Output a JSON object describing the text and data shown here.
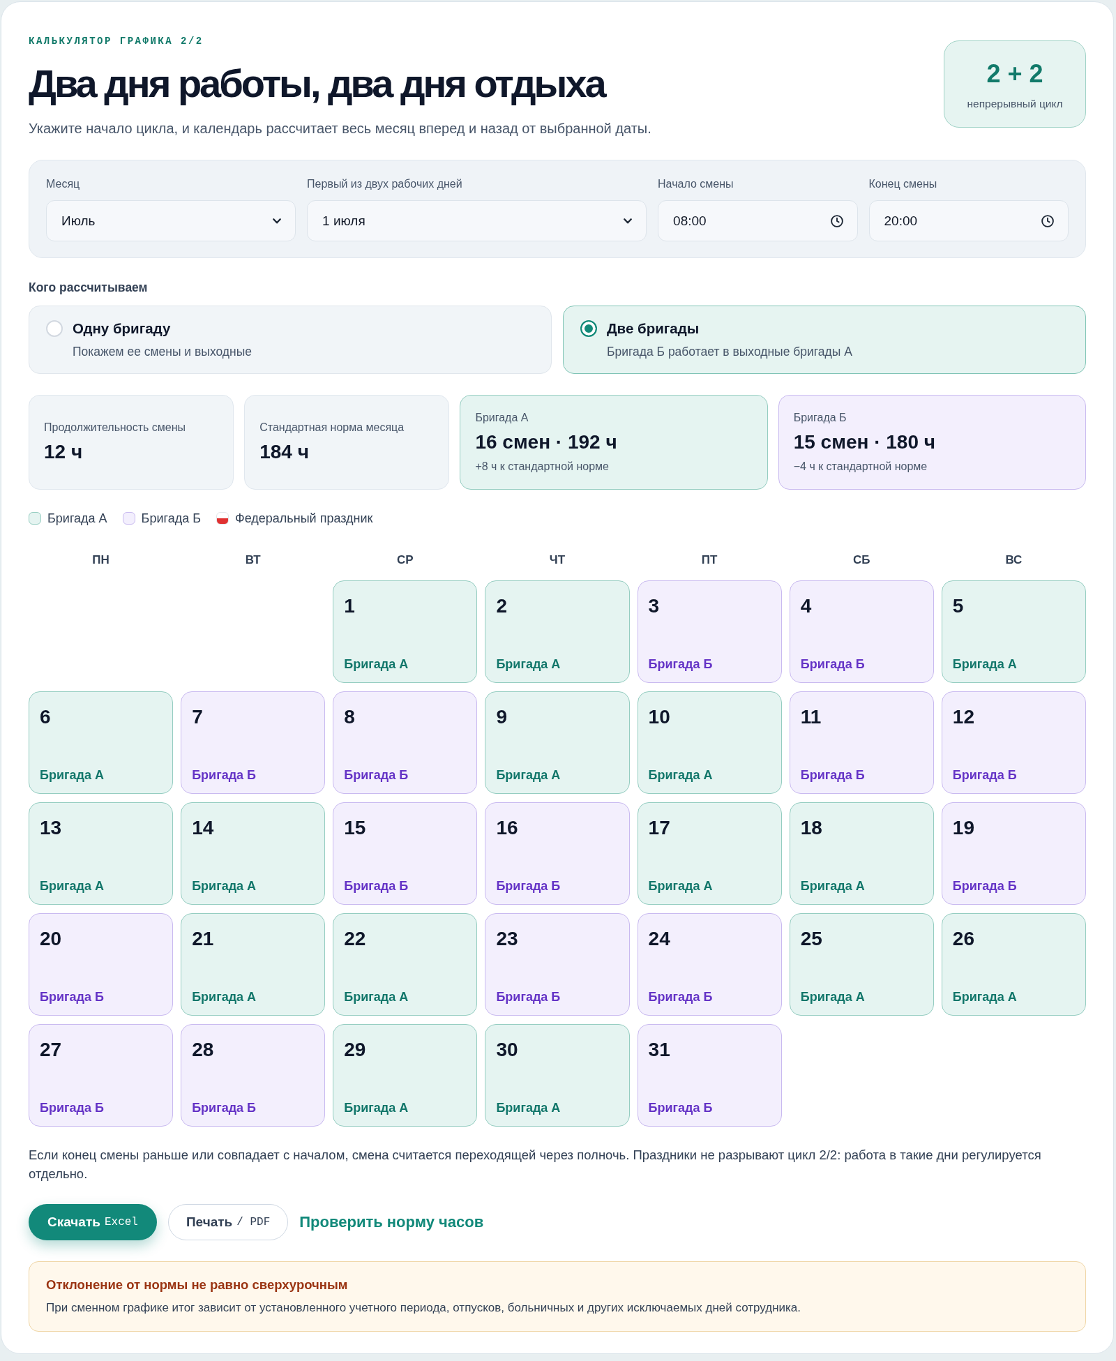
{
  "header": {
    "eyebrow": "КАЛЬКУЛЯТОР ГРАФИКА 2/2",
    "title": "Два дня работы, два дня отдыха",
    "subtitle": "Укажите начало цикла, и календарь рассчитает весь месяц вперед и назад от выбранной даты."
  },
  "badge": {
    "value": "2 + 2",
    "caption": "непрерывный цикл"
  },
  "settings": {
    "fields": [
      {
        "label": "Месяц",
        "value": "Июль",
        "kind": "select"
      },
      {
        "label": "Первый из двух рабочих дней",
        "value": "1 июля",
        "kind": "select"
      },
      {
        "label": "Начало смены",
        "value": "08:00",
        "kind": "time"
      },
      {
        "label": "Конец смены",
        "value": "20:00",
        "kind": "time"
      }
    ]
  },
  "mode": {
    "title": "Кого рассчитываем",
    "options": [
      {
        "title": "Одну бригаду",
        "description": "Покажем ее смены и выходные",
        "selected": false
      },
      {
        "title": "Две бригады",
        "description": "Бригада Б работает в выходные бригады А",
        "selected": true
      }
    ]
  },
  "stats": [
    {
      "label": "Продолжительность смены",
      "value": "12 ч",
      "kind": "neutral"
    },
    {
      "label": "Стандартная норма месяца",
      "value": "184 ч",
      "kind": "neutral"
    },
    {
      "label": "Бригада А",
      "value": "16 смен · 192 ч",
      "note": "+8 ч к стандартной норме",
      "kind": "a"
    },
    {
      "label": "Бригада Б",
      "value": "15 смен · 180 ч",
      "note": "−4 ч к стандартной норме",
      "kind": "b"
    }
  ],
  "legend": [
    {
      "label": "Бригада А",
      "kind": "a"
    },
    {
      "label": "Бригада Б",
      "kind": "b"
    },
    {
      "label": "Федеральный праздник",
      "kind": "holiday"
    }
  ],
  "calendar": {
    "weekdays": [
      "ПН",
      "ВТ",
      "СР",
      "ЧТ",
      "ПТ",
      "СБ",
      "ВС"
    ],
    "cells": [
      {
        "kind": "blank"
      },
      {
        "kind": "blank"
      },
      {
        "day": "1",
        "label": "Бригада А",
        "kind": "a"
      },
      {
        "day": "2",
        "label": "Бригада А",
        "kind": "a"
      },
      {
        "day": "3",
        "label": "Бригада Б",
        "kind": "b"
      },
      {
        "day": "4",
        "label": "Бригада Б",
        "kind": "b"
      },
      {
        "day": "5",
        "label": "Бригада А",
        "kind": "a"
      },
      {
        "day": "6",
        "label": "Бригада А",
        "kind": "a"
      },
      {
        "day": "7",
        "label": "Бригада Б",
        "kind": "b"
      },
      {
        "day": "8",
        "label": "Бригада Б",
        "kind": "b"
      },
      {
        "day": "9",
        "label": "Бригада А",
        "kind": "a"
      },
      {
        "day": "10",
        "label": "Бригада А",
        "kind": "a"
      },
      {
        "day": "11",
        "label": "Бригада Б",
        "kind": "b"
      },
      {
        "day": "12",
        "label": "Бригада Б",
        "kind": "b"
      },
      {
        "day": "13",
        "label": "Бригада А",
        "kind": "a"
      },
      {
        "day": "14",
        "label": "Бригада А",
        "kind": "a"
      },
      {
        "day": "15",
        "label": "Бригада Б",
        "kind": "b"
      },
      {
        "day": "16",
        "label": "Бригада Б",
        "kind": "b"
      },
      {
        "day": "17",
        "label": "Бригада А",
        "kind": "a"
      },
      {
        "day": "18",
        "label": "Бригада А",
        "kind": "a"
      },
      {
        "day": "19",
        "label": "Бригада Б",
        "kind": "b"
      },
      {
        "day": "20",
        "label": "Бригада Б",
        "kind": "b"
      },
      {
        "day": "21",
        "label": "Бригада А",
        "kind": "a"
      },
      {
        "day": "22",
        "label": "Бригада А",
        "kind": "a"
      },
      {
        "day": "23",
        "label": "Бригада Б",
        "kind": "b"
      },
      {
        "day": "24",
        "label": "Бригада Б",
        "kind": "b"
      },
      {
        "day": "25",
        "label": "Бригада А",
        "kind": "a"
      },
      {
        "day": "26",
        "label": "Бригада А",
        "kind": "a"
      },
      {
        "day": "27",
        "label": "Бригада Б",
        "kind": "b"
      },
      {
        "day": "28",
        "label": "Бригада Б",
        "kind": "b"
      },
      {
        "day": "29",
        "label": "Бригада А",
        "kind": "a"
      },
      {
        "day": "30",
        "label": "Бригада А",
        "kind": "a"
      },
      {
        "day": "31",
        "label": "Бригада Б",
        "kind": "b"
      }
    ]
  },
  "footnote": "Если конец смены раньше или совпадает с началом, смена считается переходящей через полночь. Праздники не разрывают цикл 2/2: работа в такие дни регулируется отдельно.",
  "actions": [
    {
      "kind": "primary",
      "label": "Скачать",
      "suffix": "Excel"
    },
    {
      "kind": "secondary",
      "label": "Печать",
      "suffix": "/ PDF"
    },
    {
      "kind": "link",
      "label": "Проверить норму часов"
    }
  ],
  "alert": {
    "title": "Отклонение от нормы не равно сверхурочным",
    "text": "При сменном графике итог зависит от установленного учетного периода, отпусков, больничных и других исключаемых дней сотрудника."
  }
}
